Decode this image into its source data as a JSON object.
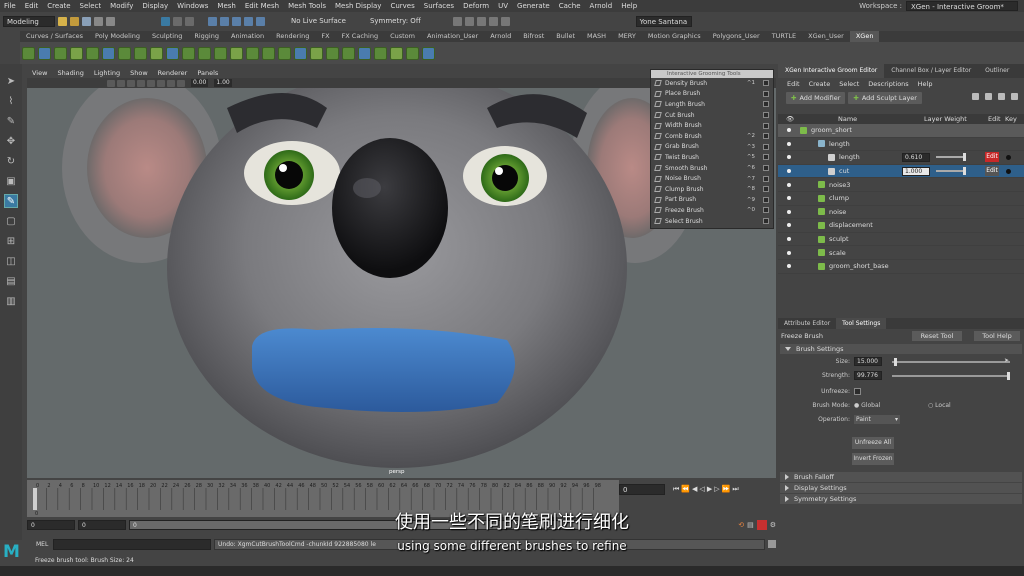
{
  "menubar": [
    "File",
    "Edit",
    "Create",
    "Select",
    "Modify",
    "Display",
    "Windows",
    "Mesh",
    "Edit Mesh",
    "Mesh Tools",
    "Mesh Display",
    "Curves",
    "Surfaces",
    "Deform",
    "UV",
    "Generate",
    "Cache",
    "Arnold",
    "Help"
  ],
  "workspace": {
    "label": "Workspace :",
    "value": "XGen - Interactive Groom*"
  },
  "status": {
    "mode": "Modeling",
    "live": "No Live Surface",
    "symmetry": "Symmetry: Off",
    "user": "Yone Santana"
  },
  "shelf_tabs": [
    "Curves / Surfaces",
    "Poly Modeling",
    "Sculpting",
    "Rigging",
    "Animation",
    "Rendering",
    "FX",
    "FX Caching",
    "Custom",
    "Animation_User",
    "Arnold",
    "Bifrost",
    "Bullet",
    "MASH",
    "MERY",
    "Motion Graphics",
    "Polygons_User",
    "TURTLE",
    "XGen_User",
    "XGen"
  ],
  "shelf_active": "XGen",
  "viewport": {
    "menu": [
      "View",
      "Shading",
      "Lighting",
      "Show",
      "Renderer",
      "Panels"
    ],
    "num1": "0.00",
    "num2": "1.00",
    "camera": "persp"
  },
  "groom_tools": {
    "title": "Interactive Grooming Tools",
    "items": [
      {
        "label": "Density Brush",
        "key": "^1"
      },
      {
        "label": "Place Brush",
        "key": ""
      },
      {
        "label": "Length Brush",
        "key": ""
      },
      {
        "label": "Cut Brush",
        "key": ""
      },
      {
        "label": "Width Brush",
        "key": ""
      },
      {
        "label": "Comb Brush",
        "key": "^2"
      },
      {
        "label": "Grab Brush",
        "key": "^3"
      },
      {
        "label": "Twist Brush",
        "key": "^5"
      },
      {
        "label": "Smooth Brush",
        "key": "^6"
      },
      {
        "label": "Noise Brush",
        "key": "^7"
      },
      {
        "label": "Clump Brush",
        "key": "^8"
      },
      {
        "label": "Part Brush",
        "key": "^9"
      },
      {
        "label": "Freeze Brush",
        "key": "^0"
      },
      {
        "label": "Select Brush",
        "key": ""
      }
    ]
  },
  "editor": {
    "tabs": [
      "XGen Interactive Groom Editor",
      "Channel Box / Layer Editor",
      "Outliner"
    ],
    "menu": [
      "Edit",
      "Create",
      "Select",
      "Descriptions",
      "Help"
    ],
    "add_modifier": "Add Modifier",
    "add_layer": "Add Sculpt Layer",
    "cols": {
      "name": "Name",
      "weight": "Layer Weight",
      "edit": "Edit",
      "key": "Key"
    },
    "rows": [
      {
        "name": "groom_short",
        "indent": 22,
        "icon": "groom",
        "color": "#7dbb4a"
      },
      {
        "name": "length",
        "indent": 40,
        "icon": "folder",
        "color": "#8ab4cc"
      },
      {
        "name": "length",
        "indent": 50,
        "icon": "layer",
        "color": "#cfcfcf",
        "value": "0.610",
        "edit": "Edit"
      },
      {
        "name": "cut",
        "indent": 50,
        "icon": "layer",
        "color": "#cfcfcf",
        "value": "1.000",
        "edit": "Edit"
      },
      {
        "name": "noise3",
        "indent": 40,
        "icon": "mod",
        "color": "#7dbb4a"
      },
      {
        "name": "clump",
        "indent": 40,
        "icon": "mod",
        "color": "#7dbb4a"
      },
      {
        "name": "noise",
        "indent": 40,
        "icon": "mod",
        "color": "#7dbb4a"
      },
      {
        "name": "displacement",
        "indent": 40,
        "icon": "mod",
        "color": "#7dbb4a"
      },
      {
        "name": "sculpt",
        "indent": 40,
        "icon": "mod",
        "color": "#7dbb4a"
      },
      {
        "name": "scale",
        "indent": 40,
        "icon": "mod",
        "color": "#7dbb4a"
      },
      {
        "name": "groom_short_base",
        "indent": 40,
        "icon": "base",
        "color": "#7dbb4a"
      }
    ]
  },
  "attr": {
    "tabs": [
      "Attribute Editor",
      "Tool Settings"
    ],
    "tool": "Freeze Brush",
    "reset": "Reset Tool",
    "help": "Tool Help",
    "brush_settings": "Brush Settings",
    "size_label": "Size:",
    "size": "15.000",
    "size_level": 0.02,
    "strength_label": "Strength:",
    "strength": "99.776",
    "strength_level": 0.998,
    "unfreeze": "Unfreeze:",
    "mode_label": "Brush Mode:",
    "mode_global": "Global",
    "mode_local": "Local",
    "op_label": "Operation:",
    "op": "Paint",
    "unfreeze_all": "Unfreeze All",
    "invert": "Invert Frozen",
    "sections": [
      "Brush Falloff",
      "Display Settings",
      "Symmetry Settings"
    ]
  },
  "timeline": {
    "ticks": [
      "0",
      "2",
      "4",
      "6",
      "8",
      "10",
      "12",
      "14",
      "16",
      "18",
      "20",
      "22",
      "24",
      "26",
      "28",
      "30",
      "32",
      "34",
      "36",
      "38",
      "40",
      "42",
      "44",
      "46",
      "48",
      "50",
      "52",
      "54",
      "56",
      "58",
      "60",
      "62",
      "64",
      "66",
      "68",
      "70",
      "72",
      "74",
      "76",
      "78",
      "80",
      "82",
      "84",
      "86",
      "88",
      "90",
      "92",
      "94",
      "96",
      "98"
    ],
    "current": "0",
    "frame": "0"
  },
  "range": {
    "start": "0",
    "s2": "0",
    "s3": "0"
  },
  "cmd": {
    "mel": "MEL",
    "output": "Undo: XgmCutBrushToolCmd -chunkId 922885080 le"
  },
  "help_line": "Freeze brush tool: Brush Size: 24",
  "subtitle_cn": "使用一些不同的笔刷进行细化",
  "subtitle_en": "using some different brushes to refine"
}
